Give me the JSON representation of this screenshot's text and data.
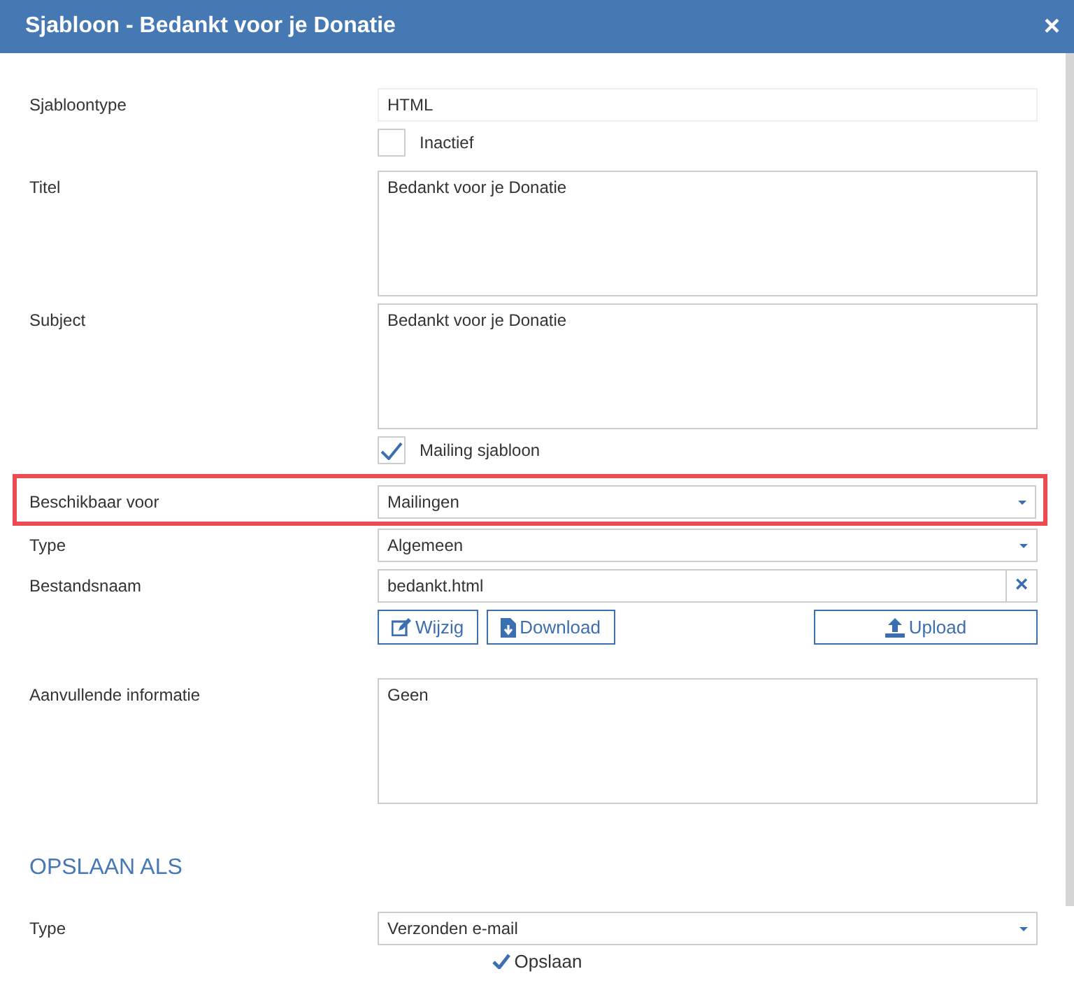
{
  "window": {
    "title": "Sjabloon - Bedankt voor je Donatie",
    "close": "×"
  },
  "fields": [
    {
      "kind": "text",
      "label": "Sjabloontype",
      "value": "HTML"
    },
    {
      "kind": "checkbox",
      "text": "Inactief",
      "checked": false
    },
    {
      "kind": "textarea",
      "label": "Titel",
      "value": "Bedankt voor je Donatie"
    },
    {
      "kind": "textarea",
      "label": "Subject",
      "value": "Bedankt voor je Donatie"
    },
    {
      "kind": "checkbox",
      "text": "Mailing sjabloon",
      "checked": true
    },
    {
      "kind": "select",
      "label": "Beschikbaar voor",
      "value": "Mailingen",
      "highlighted": true
    },
    {
      "kind": "select",
      "label": "Type",
      "value": "Algemeen",
      "highlighted": false
    },
    {
      "kind": "file",
      "label": "Bestandsnaam",
      "value": "bedankt.html",
      "clear": "×"
    },
    {
      "kind": "buttons",
      "buttons": [
        {
          "kind": "edit",
          "label": "Wijzig"
        },
        {
          "kind": "download",
          "label": "Download"
        },
        {
          "kind": "upload",
          "label": "Upload"
        }
      ]
    },
    {
      "kind": "textarea",
      "label": "Aanvullende informatie",
      "value": "Geen"
    }
  ],
  "save_as": {
    "heading": "OPSLAAN ALS",
    "fields": [
      {
        "kind": "select",
        "label": "Type",
        "value": "Verzonden e-mail",
        "highlighted": false
      }
    ]
  },
  "footer": {
    "save_button": "Opslaan"
  }
}
